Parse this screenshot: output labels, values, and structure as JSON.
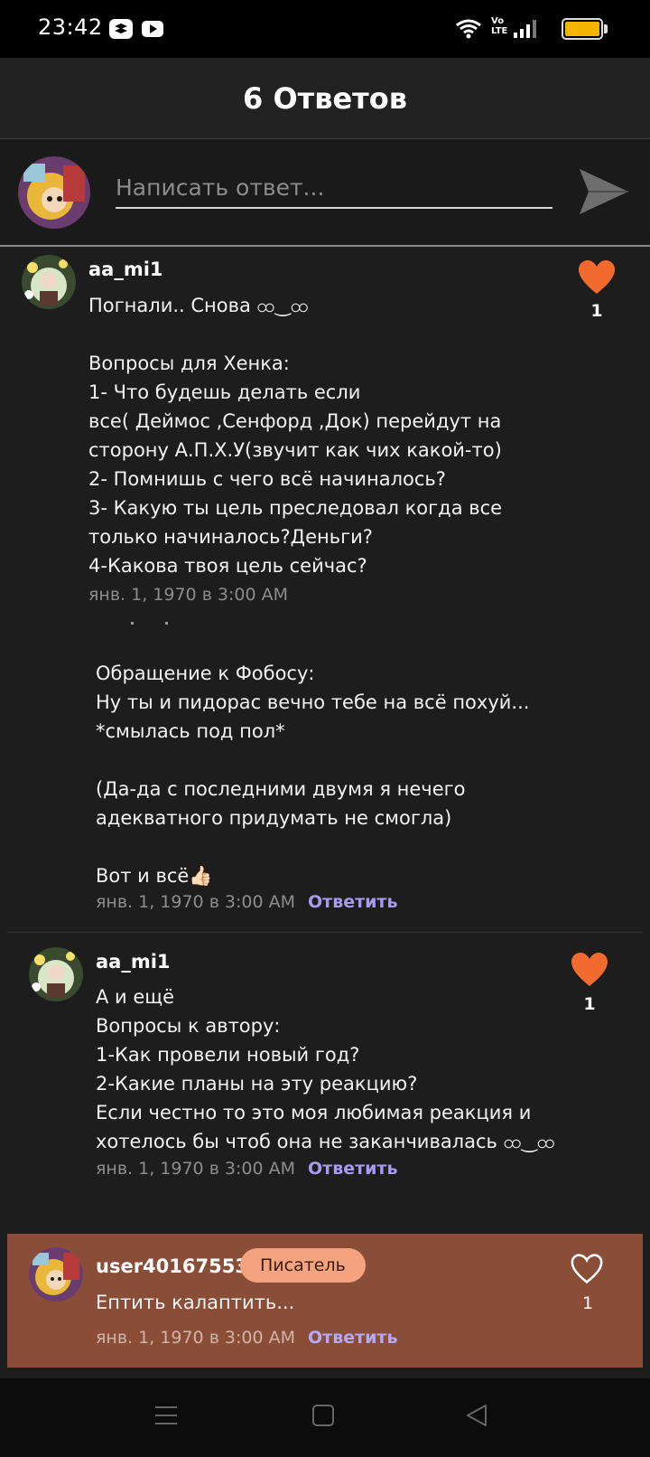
{
  "status_bar": {
    "time": "23:42",
    "volte_label": "Vo\nLTE"
  },
  "header": {
    "title": "6 Ответов"
  },
  "reply_bar": {
    "placeholder": "Написать ответ..."
  },
  "comments": [
    {
      "username": "aa_mi1",
      "text": "Погнали.. Снова ထ‿ထ\n\nВопросы для Хенка:\n1- Что будешь делать если\nвсе( Деймос ,Сенфорд ,Док) перейдут на\nсторону А.П.Х.У(звучит как чих какой-то)\n2- Помнишь с чего всё начиналось?\n3- Какую ты цель преследовал когда все\nтолько начиналось?Деньги?\n4-Какова твоя цель сейчас?",
      "date": "янв. 1, 1970 в 3:00 AM",
      "likes": "1"
    },
    {
      "text": "Обращение к Фобосу:\nНу ты и пидорас вечно тебе на всё похуй...\n*смылась под пол*\n\n(Да-да с последними двумя я нечего\nадекватного придумать не смогла)\n\nВот и всё👍🏻",
      "date": "янв. 1, 1970 в 3:00 AM",
      "reply_label": "Ответить"
    },
    {
      "username": "aa_mi1",
      "text": "А и ещё\nВопросы к автору:\n1-Как провели новый год?\n2-Какие планы на эту реакцию?\nЕсли честно то это моя любимая реакция и\nхотелось бы чтоб она не заканчивалась ထ‿ထ",
      "date": "янв. 1, 1970 в 3:00 AM",
      "reply_label": "Ответить",
      "likes": "1"
    },
    {
      "username": "user40167553",
      "badge": "Писатель",
      "text": "Ептить калаптить...",
      "date": "янв. 1, 1970 в 3:00 AM",
      "reply_label": "Ответить",
      "likes": "1"
    }
  ],
  "colors": {
    "accent_like": "#f26a2e",
    "reply_link": "#a99af0",
    "highlight_bg": "#8a4d38",
    "badge_bg": "#f3a47e"
  }
}
